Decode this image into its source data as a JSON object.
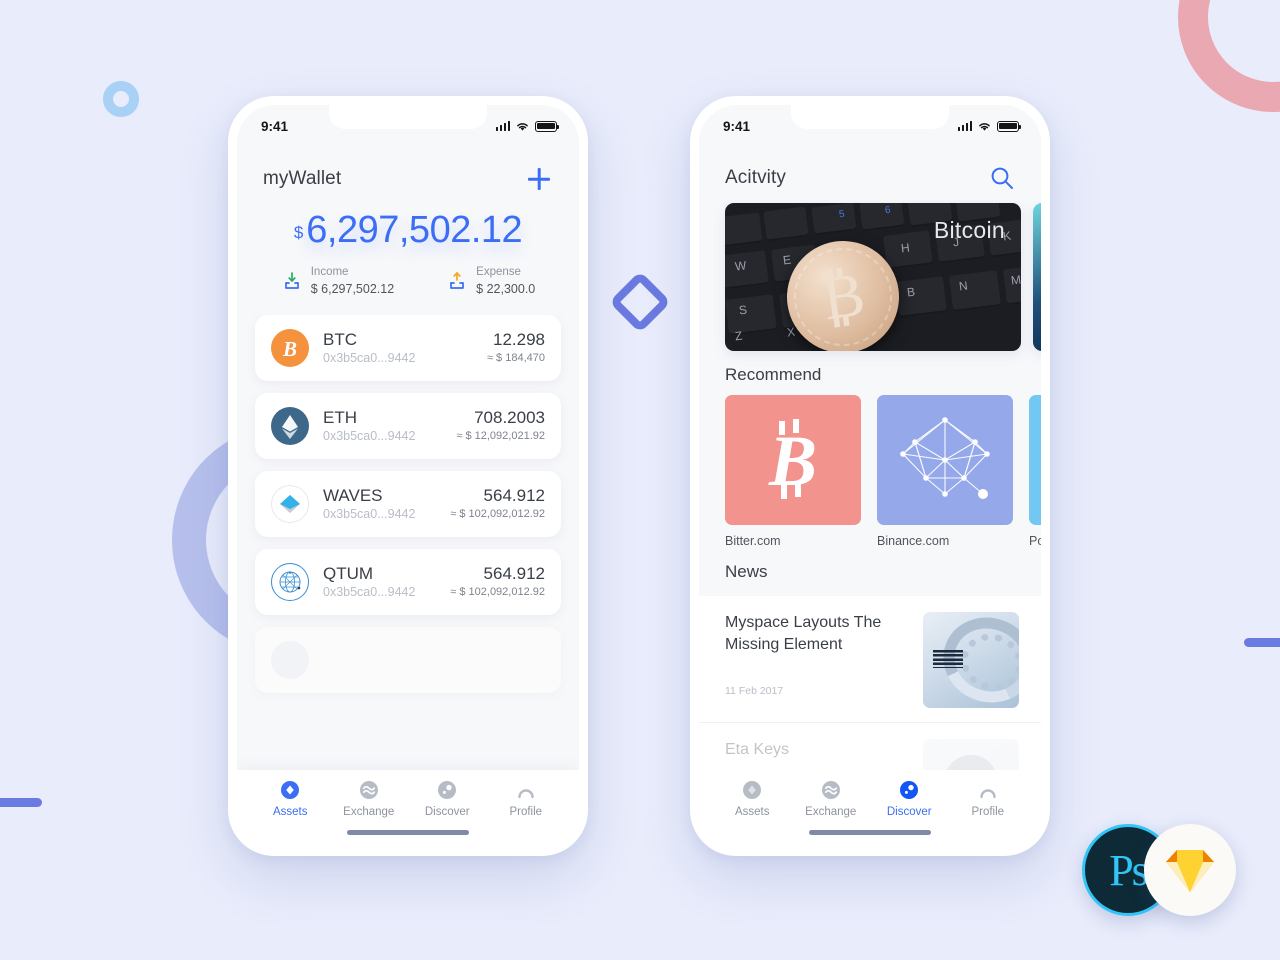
{
  "background": {
    "page_bg": "#e8ecfb",
    "shapes": [
      {
        "name": "ring-light-blue",
        "color": "#a9d0f5"
      },
      {
        "name": "ring-periwinkle",
        "color": "#b7c0ec"
      },
      {
        "name": "ring-pink",
        "color": "#e9a8b2"
      },
      {
        "name": "diamond-outline",
        "color": "#6b7ae0"
      },
      {
        "name": "bar-left",
        "color": "#6b7ae0"
      },
      {
        "name": "bar-right",
        "color": "#6b7ae0"
      }
    ]
  },
  "accent": "#3b6ef5",
  "phone1": {
    "status_bar": {
      "time": "9:41"
    },
    "header": {
      "title": "myWallet",
      "add_label": "+"
    },
    "balance": {
      "currency_symbol": "$",
      "amount": "6,297,502.12",
      "income_label": "Income",
      "income_value": "$ 6,297,502.12",
      "expense_label": "Expense",
      "expense_value": "$ 22,300.0"
    },
    "assets": [
      {
        "symbol": "BTC",
        "address": "0x3b5ca0...9442",
        "quantity": "12.298",
        "usd": "≈ $ 184,470",
        "color": "#f5923e"
      },
      {
        "symbol": "ETH",
        "address": "0x3b5ca0...9442",
        "quantity": "708.2003",
        "usd": "≈ $ 12,092,021.92",
        "color": "#3d6889"
      },
      {
        "symbol": "WAVES",
        "address": "0x3b5ca0...9442",
        "quantity": "564.912",
        "usd": "≈ $ 102,092,012.92",
        "color": "#32b2e8"
      },
      {
        "symbol": "QTUM",
        "address": "0x3b5ca0...9442",
        "quantity": "564.912",
        "usd": "≈ $ 102,092,012.92",
        "color": "#3a8fd4"
      }
    ],
    "tabs": [
      {
        "label": "Assets",
        "icon": "diamond-icon",
        "active": true
      },
      {
        "label": "Exchange",
        "icon": "exchange-icon",
        "active": false
      },
      {
        "label": "Discover",
        "icon": "compass-icon",
        "active": false
      },
      {
        "label": "Profile",
        "icon": "person-icon",
        "active": false
      }
    ]
  },
  "phone2": {
    "status_bar": {
      "time": "9:41"
    },
    "header": {
      "title": "Acitvity",
      "search_icon": "search-icon"
    },
    "banner": {
      "label": "Bitcoin",
      "alt": "bitcoin coin on keyboard"
    },
    "recommend": {
      "title": "Recommend",
      "items": [
        {
          "label": "Bitter.com",
          "color": "#f2938e",
          "icon": "bitcoin-icon"
        },
        {
          "label": "Binance.com",
          "color": "#94a8ea",
          "icon": "network-icon"
        },
        {
          "label": "Polonie",
          "color": "#72c8f2",
          "icon": "sparkle-icon"
        }
      ]
    },
    "news": {
      "title": "News",
      "items": [
        {
          "title": "Myspace Layouts The Missing Element",
          "date": "11 Feb 2017",
          "thumb": "ibm-disk-image"
        },
        {
          "title": "Eta Keys",
          "date": "",
          "thumb": "portrait-image"
        }
      ]
    },
    "tabs": [
      {
        "label": "Assets",
        "icon": "diamond-icon",
        "active": false
      },
      {
        "label": "Exchange",
        "icon": "exchange-icon",
        "active": false
      },
      {
        "label": "Discover",
        "icon": "compass-icon",
        "active": true
      },
      {
        "label": "Profile",
        "icon": "person-icon",
        "active": false
      }
    ]
  },
  "badges": [
    {
      "name": "photoshop-badge",
      "text": "Ps"
    },
    {
      "name": "sketch-badge",
      "text": ""
    }
  ]
}
